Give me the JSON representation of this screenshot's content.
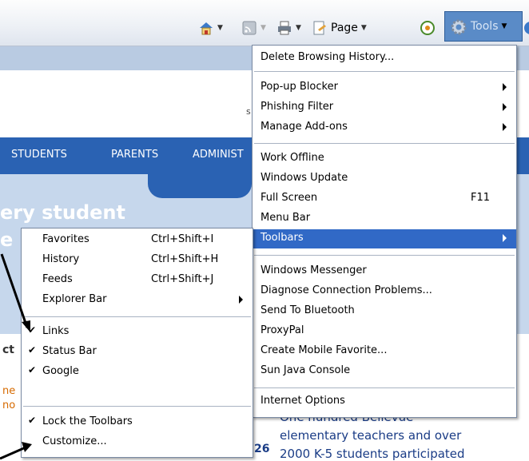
{
  "command_bar": {
    "page_label": "Page",
    "tools_label": "Tools",
    "icons": [
      "home-icon",
      "feeds-icon",
      "print-icon",
      "page-icon",
      "research-icon",
      "gear-icon",
      "help-icon"
    ]
  },
  "webpage": {
    "nav_links": [
      "STUDENTS",
      "PARENTS",
      "ADMINIST"
    ],
    "hero_text": "ery student",
    "hero_text_2": "e",
    "side_letter": "s",
    "left_fragments": [
      "ct",
      "ne",
      "no"
    ],
    "story_number": "26",
    "story_lines": [
      "One hundred Bellevue",
      "elementary teachers and over",
      "2000 K-5 students participated"
    ]
  },
  "tools_menu": {
    "groups": [
      [
        {
          "label": "Delete Browsing History..."
        }
      ],
      [
        {
          "label": "Pop-up Blocker",
          "submenu": true
        },
        {
          "label": "Phishing Filter",
          "submenu": true
        },
        {
          "label": "Manage Add-ons",
          "submenu": true
        }
      ],
      [
        {
          "label": "Work Offline"
        },
        {
          "label": "Windows Update"
        },
        {
          "label": "Full Screen",
          "shortcut": "F11"
        },
        {
          "label": "Menu Bar"
        },
        {
          "label": "Toolbars",
          "submenu": true,
          "selected": true
        }
      ],
      [
        {
          "label": "Windows Messenger"
        },
        {
          "label": "Diagnose Connection Problems..."
        },
        {
          "label": "Send To Bluetooth"
        },
        {
          "label": "ProxyPal"
        },
        {
          "label": "Create Mobile Favorite..."
        },
        {
          "label": "Sun Java Console"
        }
      ],
      [
        {
          "label": "Internet Options"
        }
      ]
    ]
  },
  "toolbars_menu": {
    "items": [
      {
        "label": "Favorites",
        "shortcut": "Ctrl+Shift+I"
      },
      {
        "label": "History",
        "shortcut": "Ctrl+Shift+H"
      },
      {
        "label": "Feeds",
        "shortcut": "Ctrl+Shift+J"
      },
      {
        "label": "Explorer Bar",
        "submenu": true
      },
      {
        "label": "Links",
        "checked": true
      },
      {
        "label": "Status Bar",
        "checked": true
      },
      {
        "label": "Google",
        "checked": true
      },
      {
        "label": "Lock the Toolbars",
        "checked": true
      },
      {
        "label": "Customize..."
      }
    ]
  },
  "colors": {
    "menu_highlight": "#3169c6",
    "nav_blue": "#2a62b3",
    "hero_blue": "#c6d7ec"
  }
}
